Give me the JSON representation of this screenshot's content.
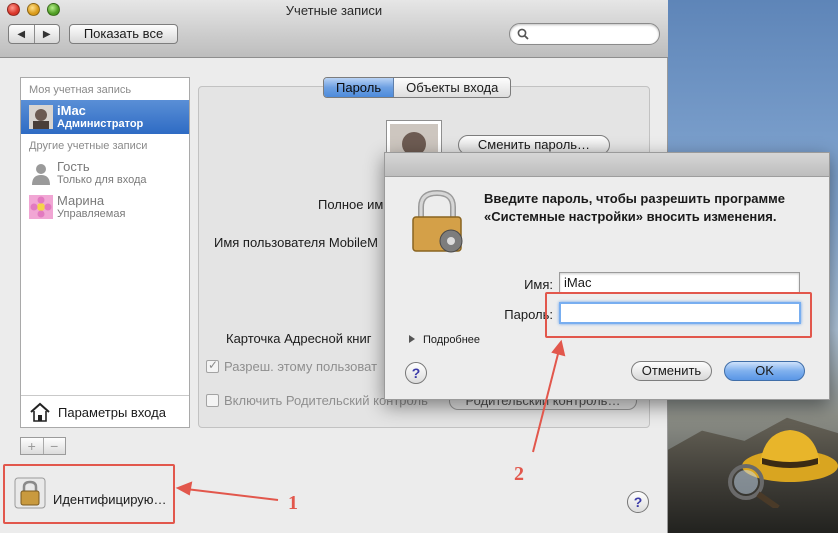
{
  "window": {
    "title": "Учетные записи",
    "back_icon": "◀",
    "forward_icon": "▶",
    "show_all_label": "Показать все",
    "search_placeholder": ""
  },
  "sidebar": {
    "my_account_header": "Моя учетная запись",
    "other_accounts_header": "Другие учетные записи",
    "current_user": {
      "name": "iMac",
      "role": "Администратор"
    },
    "other_users": [
      {
        "name": "Гость",
        "role": "Только для входа"
      },
      {
        "name": "Марина",
        "role": "Управляемая"
      }
    ],
    "login_options_label": "Параметры входа",
    "add_symbol": "+",
    "remove_symbol": "−"
  },
  "tabs": [
    {
      "label": "Пароль",
      "active": true
    },
    {
      "label": "Объекты входа",
      "active": false
    }
  ],
  "panel": {
    "change_password_label": "Сменить пароль…",
    "full_name_label": "Полное им",
    "mobileme_label": "Имя пользователя MobileM",
    "address_card_label": "Карточка Адресной книг",
    "allow_admin_label": "Разреш. этому пользоват",
    "parental_controls_label": "Включить Родительский контроль",
    "parental_controls_button": "Родительский контроль…"
  },
  "lock": {
    "label": "Идентифицирую…"
  },
  "help_symbol": "?",
  "annotations": [
    {
      "number": "1"
    },
    {
      "number": "2"
    }
  ],
  "dialog": {
    "message": "Введите пароль, чтобы разрешить программе «Системные настройки» вносить изменения.",
    "name_label": "Имя:",
    "name_value": "iMac",
    "password_label": "Пароль:",
    "password_value": "",
    "details_label": "Подробнее",
    "cancel_label": "Отменить",
    "ok_label": "OK"
  },
  "colors": {
    "accent": "#2e6bc4",
    "annotation": "#e2574c",
    "ok_button": "#5a96e6"
  }
}
